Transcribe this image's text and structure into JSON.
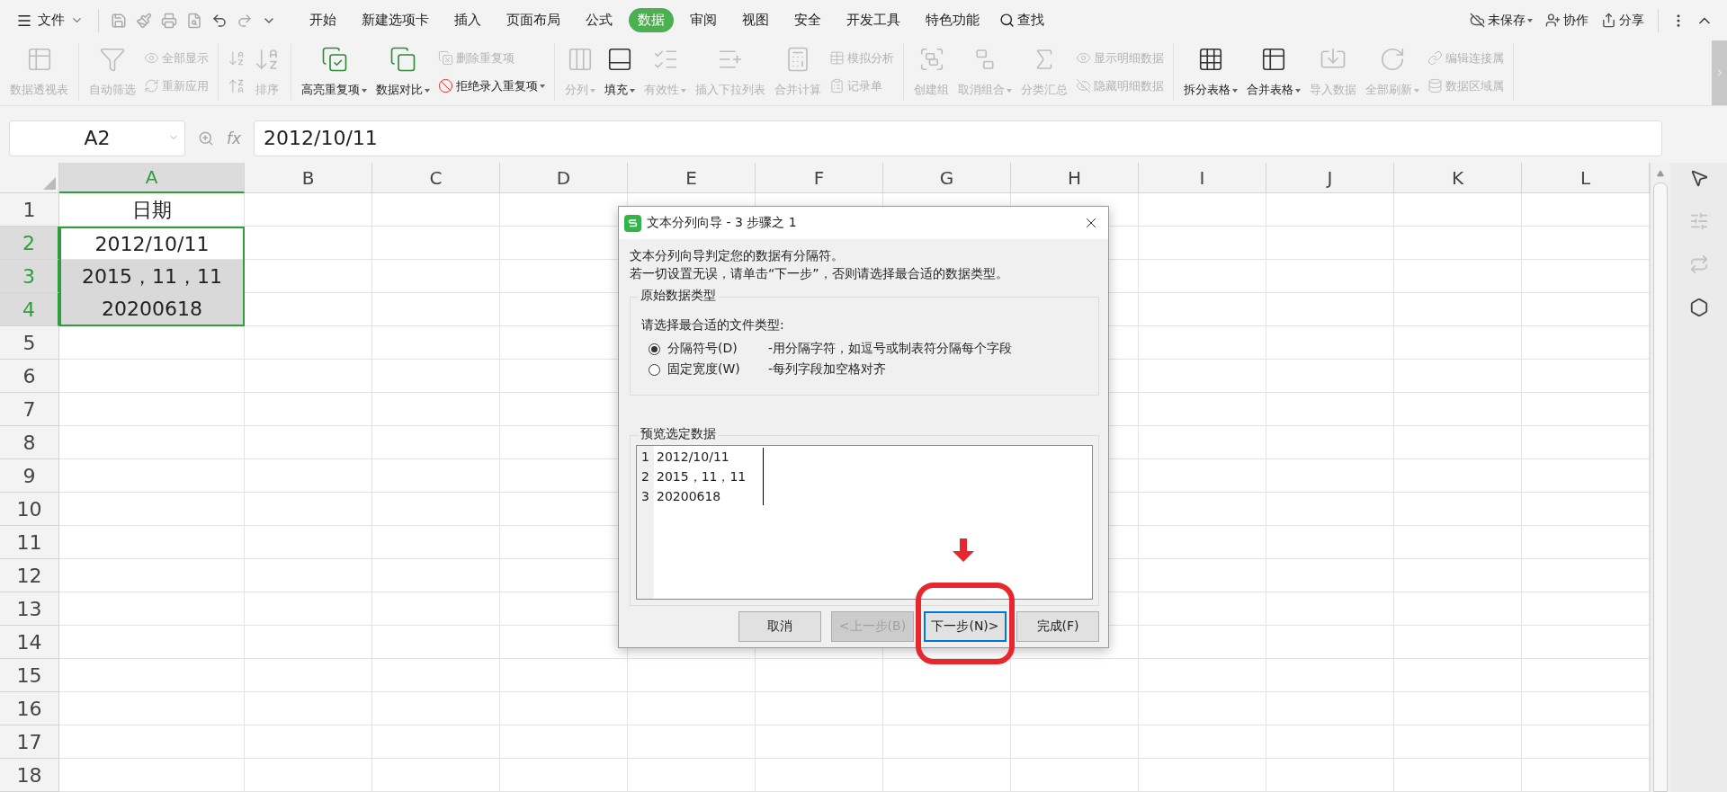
{
  "top_bar": {
    "file_menu": "文件",
    "tabs": [
      {
        "label": "开始",
        "selected": false
      },
      {
        "label": "新建选项卡",
        "selected": false
      },
      {
        "label": "插入",
        "selected": false
      },
      {
        "label": "页面布局",
        "selected": false
      },
      {
        "label": "公式",
        "selected": false
      },
      {
        "label": "数据",
        "selected": true
      },
      {
        "label": "审阅",
        "selected": false
      },
      {
        "label": "视图",
        "selected": false
      },
      {
        "label": "安全",
        "selected": false
      },
      {
        "label": "开发工具",
        "selected": false
      },
      {
        "label": "特色功能",
        "selected": false
      }
    ],
    "search": "查找",
    "actions": [
      {
        "kind": "cloud",
        "label": "未保存",
        "dropdown": true
      },
      {
        "kind": "collab",
        "label": "协作",
        "dropdown": false
      },
      {
        "kind": "share",
        "label": "分享",
        "dropdown": false
      }
    ]
  },
  "ribbon": {
    "groups": [
      [
        {
          "kind": "large",
          "label": "数据透视表",
          "disabled": true,
          "dropdown": false
        }
      ],
      [
        {
          "kind": "large",
          "label": "自动筛选",
          "disabled": true,
          "dropdown": false
        },
        {
          "kind": "stack",
          "entries": [
            {
              "label": "全部显示",
              "disabled": true,
              "dropdown": false
            },
            {
              "label": "重新应用",
              "disabled": true,
              "dropdown": false
            }
          ]
        }
      ],
      [
        {
          "kind": "sort_icons",
          "disabled": true
        },
        {
          "kind": "large",
          "label": "排序",
          "disabled": true,
          "dropdown": false
        }
      ],
      [
        {
          "kind": "large",
          "label": "高亮重复项",
          "disabled": false,
          "dropdown": true
        },
        {
          "kind": "large",
          "label": "数据对比",
          "disabled": false,
          "dropdown": true
        },
        {
          "kind": "stack",
          "entries": [
            {
              "label": "删除重复项",
              "disabled": true,
              "dropdown": false
            },
            {
              "label": "拒绝录入重复项",
              "disabled": false,
              "dropdown": true
            }
          ]
        }
      ],
      [
        {
          "kind": "large",
          "label": "分列",
          "disabled": true,
          "dropdown": true
        },
        {
          "kind": "large",
          "label": "填充",
          "disabled": false,
          "dropdown": true
        },
        {
          "kind": "large",
          "label": "有效性",
          "disabled": true,
          "dropdown": true
        },
        {
          "kind": "large",
          "label": "插入下拉列表",
          "disabled": true,
          "dropdown": false
        },
        {
          "kind": "large",
          "label": "合并计算",
          "disabled": true,
          "dropdown": false
        },
        {
          "kind": "stack",
          "entries": [
            {
              "label": "模拟分析",
              "disabled": true,
              "dropdown": false
            },
            {
              "label": "记录单",
              "disabled": true,
              "dropdown": false
            }
          ]
        }
      ],
      [
        {
          "kind": "large",
          "label": "创建组",
          "disabled": true,
          "dropdown": false
        },
        {
          "kind": "large",
          "label": "取消组合",
          "disabled": true,
          "dropdown": true
        },
        {
          "kind": "large",
          "label": "分类汇总",
          "disabled": true,
          "dropdown": false
        },
        {
          "kind": "stack",
          "entries": [
            {
              "label": "显示明细数据",
              "disabled": true,
              "dropdown": false
            },
            {
              "label": "隐藏明细数据",
              "disabled": true,
              "dropdown": false
            }
          ]
        }
      ],
      [
        {
          "kind": "large",
          "label": "拆分表格",
          "disabled": false,
          "dropdown": true
        },
        {
          "kind": "large",
          "label": "合并表格",
          "disabled": false,
          "dropdown": true
        },
        {
          "kind": "large",
          "label": "导入数据",
          "disabled": true,
          "dropdown": false
        },
        {
          "kind": "large",
          "label": "全部刷新",
          "disabled": true,
          "dropdown": true
        },
        {
          "kind": "stack",
          "entries": [
            {
              "label": "编辑连接属",
              "disabled": true,
              "dropdown": false
            },
            {
              "label": "数据区域属",
              "disabled": true,
              "dropdown": false
            }
          ]
        }
      ]
    ]
  },
  "formula_bar": {
    "name_box": "A2",
    "fx": "fx",
    "value": "2012/10/11"
  },
  "sheet": {
    "columns": [
      {
        "label": "A",
        "selected": true
      },
      {
        "label": "B",
        "selected": false
      },
      {
        "label": "C",
        "selected": false
      },
      {
        "label": "D",
        "selected": false
      },
      {
        "label": "E",
        "selected": false
      },
      {
        "label": "F",
        "selected": false
      },
      {
        "label": "G",
        "selected": false
      },
      {
        "label": "H",
        "selected": false
      },
      {
        "label": "I",
        "selected": false
      },
      {
        "label": "J",
        "selected": false
      },
      {
        "label": "K",
        "selected": false
      },
      {
        "label": "L",
        "selected": false
      }
    ],
    "rows": [
      {
        "number": "1",
        "selected": false,
        "cells": [
          {
            "text": "日期",
            "selected": false,
            "active": false
          }
        ]
      },
      {
        "number": "2",
        "selected": true,
        "cells": [
          {
            "text": "2012/10/11",
            "selected": true,
            "active": true
          }
        ]
      },
      {
        "number": "3",
        "selected": true,
        "cells": [
          {
            "text": "2015，11，11",
            "selected": true,
            "active": false
          }
        ]
      },
      {
        "number": "4",
        "selected": true,
        "cells": [
          {
            "text": "20200618",
            "selected": true,
            "active": false
          }
        ]
      },
      {
        "number": "5",
        "selected": false
      },
      {
        "number": "6",
        "selected": false
      },
      {
        "number": "7",
        "selected": false
      },
      {
        "number": "8",
        "selected": false
      },
      {
        "number": "9",
        "selected": false
      },
      {
        "number": "10",
        "selected": false
      },
      {
        "number": "11",
        "selected": false
      },
      {
        "number": "12",
        "selected": false
      },
      {
        "number": "13",
        "selected": false
      },
      {
        "number": "14",
        "selected": false
      },
      {
        "number": "15",
        "selected": false
      },
      {
        "number": "16",
        "selected": false
      },
      {
        "number": "17",
        "selected": false
      },
      {
        "number": "18",
        "selected": false
      }
    ]
  },
  "dialog": {
    "title": "文本分列向导 - 3 步骤之 1",
    "intro": [
      "文本分列向导判定您的数据有分隔符。",
      "若一切设置无误，请单击“下一步”，否则请选择最合适的数据类型。"
    ],
    "type_group": {
      "legend": "原始数据类型",
      "prompt": "请选择最合适的文件类型:",
      "options": [
        {
          "label": "分隔符号(D)",
          "description": "-用分隔字符，如逗号或制表符分隔每个字段",
          "selected": true
        },
        {
          "label": "固定宽度(W)",
          "description": "-每列字段加空格对齐",
          "selected": false
        }
      ]
    },
    "preview": {
      "legend": "预览选定数据",
      "lines": [
        {
          "number": "1",
          "text": "2012/10/11"
        },
        {
          "number": "2",
          "text": "2015，11，11"
        },
        {
          "number": "3",
          "text": "20200618"
        }
      ]
    },
    "buttons": [
      {
        "label": "取消",
        "disabled": false,
        "focused": false,
        "highlighted": false
      },
      {
        "label": "<上一步(B)",
        "disabled": true,
        "focused": false,
        "highlighted": false
      },
      {
        "label": "下一步(N)>",
        "disabled": false,
        "focused": true,
        "highlighted": true
      },
      {
        "label": "完成(F)",
        "disabled": false,
        "focused": false,
        "highlighted": false
      }
    ]
  }
}
